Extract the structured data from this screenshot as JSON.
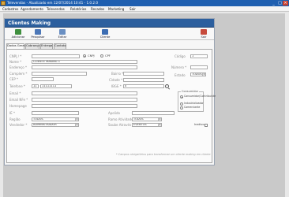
{
  "window": {
    "title": "Televendas - Atualizado em 12/07/2014 10:41 - 1.0.2.0"
  },
  "menu": [
    "Cadastros",
    "Agendamento",
    "Televendas",
    "Relatórios",
    "Recados",
    "Marketing",
    "Sair"
  ],
  "panel": {
    "title": "Clientes Making"
  },
  "toolbar": {
    "add": "Adicionar",
    "search": "Pesquisar",
    "edit": "Editar",
    "client": "Cliente",
    "exit": "Sair"
  },
  "tabs": [
    "Dados Gerais",
    "Cobrança",
    "Entrega",
    "Contato"
  ],
  "form": {
    "cnpj_label": "CNPJ / *",
    "cnpj_option": "CNPJ",
    "cpf_option": "CPF",
    "code_label": "Código",
    "code_value": "1",
    "name_label": "Nome *",
    "name_value": "CLIENTE MAKING 1",
    "address_label": "Endereço *",
    "number_label": "Número *",
    "complement_label": "Complem *",
    "district_label": "Bairro *",
    "state_label": "Estado",
    "state_value": "TODOS",
    "cep_label": "CEP *",
    "city_label": "Cidade *",
    "phone_label": "Telefone *",
    "phone_ddd": "11",
    "phone_number": "11111111",
    "ibge_label": "IBGE *",
    "ibge_value": "0",
    "email_label": "Email *",
    "email_nfe_label": "Email NFe *",
    "homepage_label": "Homepage",
    "ie_label": "IE *",
    "nickname_label": "Apelido",
    "region_label": "Região",
    "region_value": "TODOS",
    "branch_label": "Ramo Atividade",
    "branch_value": "TODOS",
    "seller_label": "Vendedor *",
    "seller_value": "ADMINISTRADOR",
    "found_via_label": "Soube Através",
    "found_via_value": "EVENTOS",
    "inactive_label": "Inativo"
  },
  "consumer_group": {
    "title": "Consumidor",
    "options": [
      "Consumidor/Contribuinte",
      "Industrializador",
      "Comerciante"
    ],
    "selected_index": 0
  },
  "footnote": "* Campos obrigatórios para transformar um cliente making em cliente"
}
